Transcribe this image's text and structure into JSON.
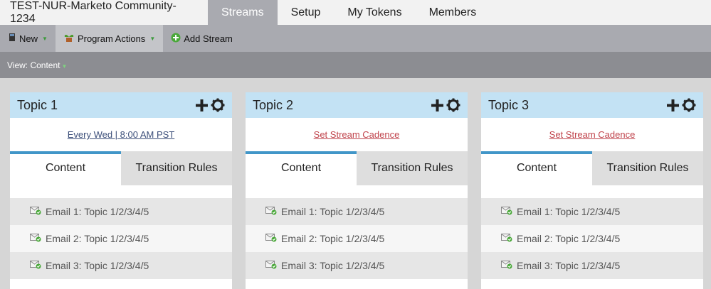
{
  "program": {
    "name": "TEST-NUR-Marketo Community-1234"
  },
  "tabs": [
    {
      "label": "Streams",
      "active": true
    },
    {
      "label": "Setup",
      "active": false
    },
    {
      "label": "My Tokens",
      "active": false
    },
    {
      "label": "Members",
      "active": false
    }
  ],
  "toolbar": {
    "new_label": "New",
    "program_actions_label": "Program Actions",
    "add_stream_label": "Add Stream"
  },
  "view": {
    "label": "View: Content"
  },
  "streams": [
    {
      "title": "Topic 1",
      "cadence": "Every Wed | 8:00 AM PST",
      "tab_content": "Content",
      "tab_rules": "Transition Rules",
      "items": [
        "Email 1: Topic 1/2/3/4/5",
        "Email 2: Topic 1/2/3/4/5",
        "Email 3: Topic 1/2/3/4/5"
      ]
    },
    {
      "title": "Topic 2",
      "cadence": "Set Stream Cadence",
      "tab_content": "Content",
      "tab_rules": "Transition Rules",
      "items": [
        "Email 1: Topic 1/2/3/4/5",
        "Email 2: Topic 1/2/3/4/5",
        "Email 3: Topic 1/2/3/4/5"
      ]
    },
    {
      "title": "Topic 3",
      "cadence": "Set Stream Cadence",
      "tab_content": "Content",
      "tab_rules": "Transition Rules",
      "items": [
        "Email 1: Topic 1/2/3/4/5",
        "Email 2: Topic 1/2/3/4/5",
        "Email 3: Topic 1/2/3/4/5"
      ]
    }
  ],
  "colors": {
    "active_tab": "#a9aab0",
    "panel_header": "#c3e2f4",
    "active_subtab_border": "#4196c8",
    "link_set_cadence": "#c0444c",
    "link_schedule": "#3c4f7a"
  },
  "icons": {
    "new": "document-icon",
    "program_actions": "plant-icon",
    "add_stream": "plus-circle-icon",
    "panel_add": "plus-icon",
    "panel_settings": "gear-icon",
    "email": "email-icon"
  }
}
